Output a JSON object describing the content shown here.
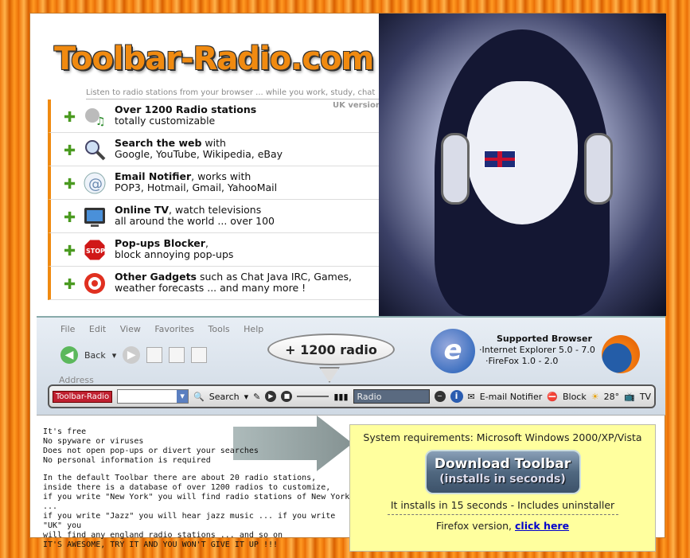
{
  "header": {
    "logo": "Toolbar-Radio.com",
    "tagline": "Listen to radio stations from your browser ... while you work, study, chat",
    "version": "UK version"
  },
  "features": [
    {
      "title": "Over 1200 Radio stations",
      "text": "totally customizable",
      "icon": "radio-icon"
    },
    {
      "title": "Search the web",
      "lead": " with",
      "text": "Google, YouTube, Wikipedia, eBay",
      "icon": "magnifier-icon"
    },
    {
      "title": "Email Notifier",
      "lead": ", works with",
      "text": "POP3, Hotmail, Gmail, YahooMail",
      "icon": "email-icon"
    },
    {
      "title": "Online TV",
      "lead": ", watch televisions",
      "text": "all around the world ... over 100",
      "icon": "tv-icon"
    },
    {
      "title": "Pop-ups Blocker",
      "lead": ",",
      "text": "block annoying pop-ups",
      "icon": "stop-icon"
    },
    {
      "title": "Other Gadgets",
      "lead": " such as Chat Java IRC, Games,",
      "text": "weather forecasts ... and many more !",
      "icon": "gadgets-icon"
    }
  ],
  "browser_demo": {
    "menu": [
      "File",
      "Edit",
      "View",
      "Favorites",
      "Tools",
      "Help"
    ],
    "back": "Back",
    "address": "Address",
    "bubble": "+ 1200 radio",
    "supported_title": "Supported Browser",
    "supported_ie": "·Internet Explorer 5.0 - 7.0",
    "supported_ff": "·FireFox 1.0 - 2.0"
  },
  "toolbar": {
    "brand": "Toolbar-Radio",
    "search": "Search",
    "radio": "Radio",
    "email": "E-mail Notifier",
    "block": "Block",
    "temp": "28°",
    "tv": "TV"
  },
  "description": {
    "lines1": [
      "It's free",
      "No spyware or viruses",
      "Does not open pop-ups or divert your searches",
      "No personal information is required"
    ],
    "lines2": [
      "In the default Toolbar there are about 20 radio stations,",
      "inside there is a database of over 1200 radios to customize,",
      "if you write \"New York\" you will find radio stations of New York ...",
      "if you write \"Jazz\" you will hear jazz music ... if you write \"UK\" you",
      "will find any england radio stations ... and so on",
      "IT'S AWESOME, TRY IT AND YOU WON'T GIVE IT UP !!!"
    ]
  },
  "requirements": {
    "system": "System requirements: Microsoft Windows 2000/XP/Vista",
    "download_line1": "Download Toolbar",
    "download_line2": "(installs in seconds)",
    "installs": "It installs in 15 seconds - Includes uninstaller",
    "firefox_prefix": "Firefox version, ",
    "firefox_link": "click here"
  }
}
